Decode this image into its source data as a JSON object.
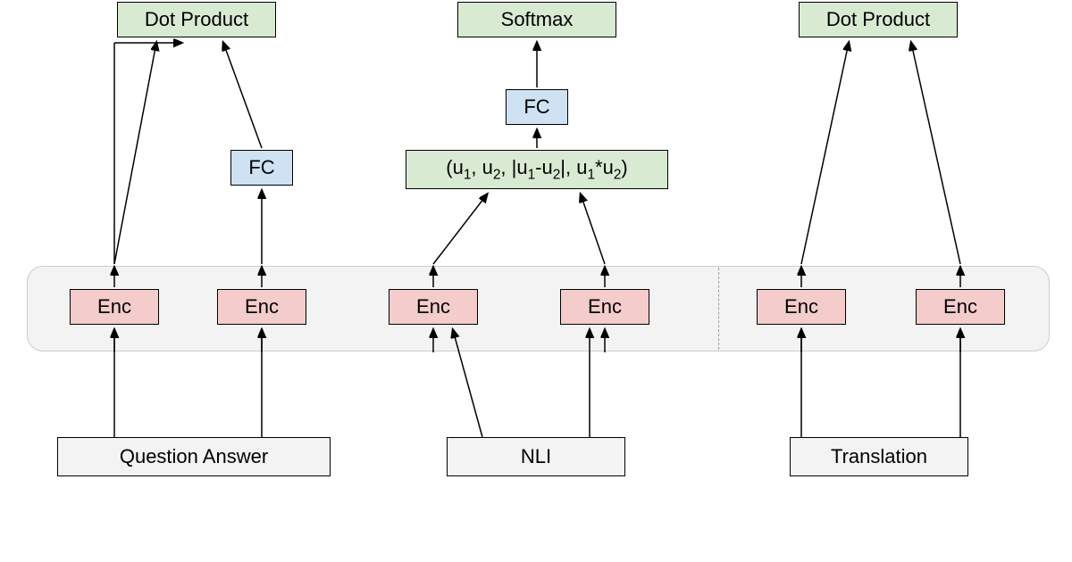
{
  "top": {
    "dot_product_left": "Dot Product",
    "softmax": "Softmax",
    "dot_product_right": "Dot Product"
  },
  "mid": {
    "fc_left": "FC",
    "fc_center": "FC",
    "concat_html": "(u<sub>1</sub>, u<sub>2</sub>, |u<sub>1</sub>-u<sub>2</sub>|, u<sub>1</sub>*u<sub>2</sub>)"
  },
  "encoders": {
    "enc1": "Enc",
    "enc2": "Enc",
    "enc3": "Enc",
    "enc4": "Enc",
    "enc5": "Enc",
    "enc6": "Enc"
  },
  "inputs": {
    "qa": "Question Answer",
    "nli": "NLI",
    "translation": "Translation"
  }
}
